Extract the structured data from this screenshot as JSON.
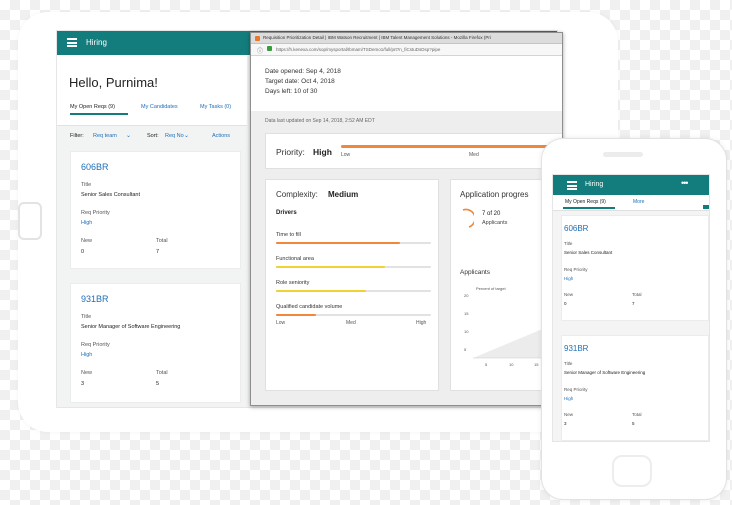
{
  "app": {
    "title": "Hiring",
    "greeting": "Hello, Purnima!"
  },
  "tabs": [
    "My Open Reqs (9)",
    "My Candidates",
    "My Tasks (0)"
  ],
  "filter": {
    "filter_label": "Filter:",
    "filter_value": "Req team",
    "sort_label": "Sort:",
    "sort_value": "Req No",
    "actions": "Actions"
  },
  "reqs": [
    {
      "id": "606BR",
      "title_label": "Title",
      "title": "Senior Sales Consultant",
      "priority_label": "Req Priority",
      "priority": "High",
      "new_label": "New",
      "new": "0",
      "total_label": "Total",
      "total": "7"
    },
    {
      "id": "931BR",
      "title_label": "Title",
      "title": "Senior Manager of Software Engineering",
      "priority_label": "Req Priority",
      "priority": "High",
      "new_label": "New",
      "new": "3",
      "total_label": "Total",
      "total": "5"
    }
  ],
  "browser": {
    "window_title": "Requisition Prioritization Detail | IBM Watson Recruitment | IBM Talent Management Solutions - Mozilla Firefox (Pri",
    "url": "https://h.kenexa.com/sop/mysportal/Ibmam/TSDemo1/full/prt?n_fiCstuDsDsp?pipe"
  },
  "details": {
    "date_opened": "Date opened: Sep 4, 2018",
    "target_date": "Target date: Oct 4, 2018",
    "days_left": "Days left: 10 of 30",
    "last_updated": "Data last updated on Sep 14, 2018, 2:52 AM EDT"
  },
  "priority": {
    "label": "Priority:",
    "value": "High",
    "scale_low": "Low",
    "scale_med": "Med"
  },
  "complexity": {
    "label": "Complexity:",
    "value": "Medium",
    "drivers_label": "Drivers",
    "drivers": [
      {
        "name": "Time to fill",
        "fraction": 0.8,
        "color": "#f0873a"
      },
      {
        "name": "Functional area",
        "fraction": 0.7,
        "color": "#f2d22e"
      },
      {
        "name": "Role seniority",
        "fraction": 0.58,
        "color": "#f2d22e"
      },
      {
        "name": "Qualified candidate volume",
        "fraction": 0.26,
        "color": "#f0873a"
      }
    ],
    "scale_low": "Low",
    "scale_med": "Med",
    "scale_high": "High"
  },
  "application": {
    "label": "Application progres",
    "count": "7 of 20",
    "count_label": "Applicants",
    "applicants_label": "Applicants",
    "chart_ylabel": "Percent of target",
    "y_ticks": [
      "20",
      "15",
      "10",
      "5"
    ],
    "x_ticks": [
      "5",
      "10",
      "15"
    ]
  },
  "phone": {
    "title": "Hiring",
    "menu": "•••",
    "tabs": [
      "My Open Reqs (9)",
      "More"
    ]
  },
  "colors": {
    "teal": "#137d7d",
    "orange": "#f0873a",
    "yellow": "#f2d22e",
    "link": "#1f6fb8"
  }
}
